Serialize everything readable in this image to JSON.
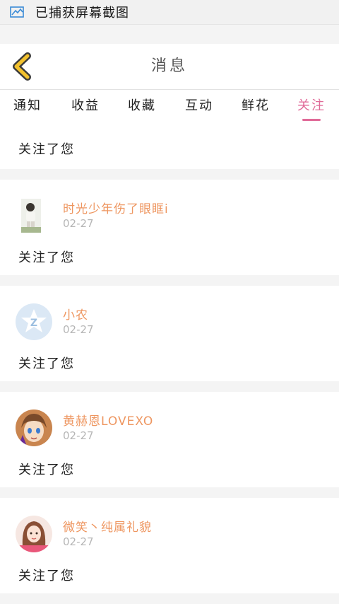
{
  "status_bar": {
    "text": "已捕获屏幕截图",
    "icon": "screenshot-icon"
  },
  "header": {
    "title": "消息",
    "back_icon": "chevron-left-icon",
    "back_icon_color": "#f2c12e"
  },
  "tabs": [
    {
      "label": "通知",
      "active": false
    },
    {
      "label": "收益",
      "active": false
    },
    {
      "label": "收藏",
      "active": false
    },
    {
      "label": "互动",
      "active": false
    },
    {
      "label": "鲜花",
      "active": false
    },
    {
      "label": "关注",
      "active": true
    }
  ],
  "accent_color": "#e06a98",
  "name_color": "#ee9660",
  "first_message": {
    "text": "关注了您"
  },
  "messages": [
    {
      "name": "时光少年伤了眼眶i",
      "date": "02-27",
      "text": "关注了您",
      "avatar": "person-photo-avatar"
    },
    {
      "name": "小农",
      "date": "02-27",
      "text": "关注了您",
      "avatar": "qzone-star-avatar"
    },
    {
      "name": "黄赫恩LOVEXO",
      "date": "02-27",
      "text": "关注了您",
      "avatar": "anime-girl-avatar"
    },
    {
      "name": "微笑丶纯属礼貌",
      "date": "02-27",
      "text": "关注了您",
      "avatar": "girl-photo-avatar"
    }
  ]
}
